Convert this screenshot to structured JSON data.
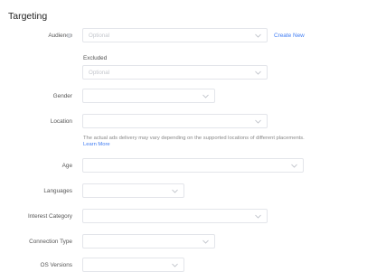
{
  "section_title": "Targeting",
  "audience": {
    "label": "Audience",
    "placeholder": "Optional",
    "create_new": "Create New",
    "excluded_label": "Excluded",
    "excluded_placeholder": "Optional"
  },
  "gender": {
    "label": "Gender"
  },
  "location": {
    "label": "Location",
    "hint": "The actual ads delivery may vary depending on the supported locations of different placements.",
    "learn_more": "Learn More"
  },
  "age": {
    "label": "Age"
  },
  "languages": {
    "label": "Languages"
  },
  "interest_category": {
    "label": "Interest Category"
  },
  "connection_type": {
    "label": "Connection Type"
  },
  "os_versions": {
    "label": "OS Versions"
  },
  "colors": {
    "link": "#3f7cf3",
    "border": "#e3e5ea",
    "placeholder": "#c3c6cc"
  },
  "icons": {
    "info": "info-icon",
    "dropdown": "chevron-down-icon"
  }
}
